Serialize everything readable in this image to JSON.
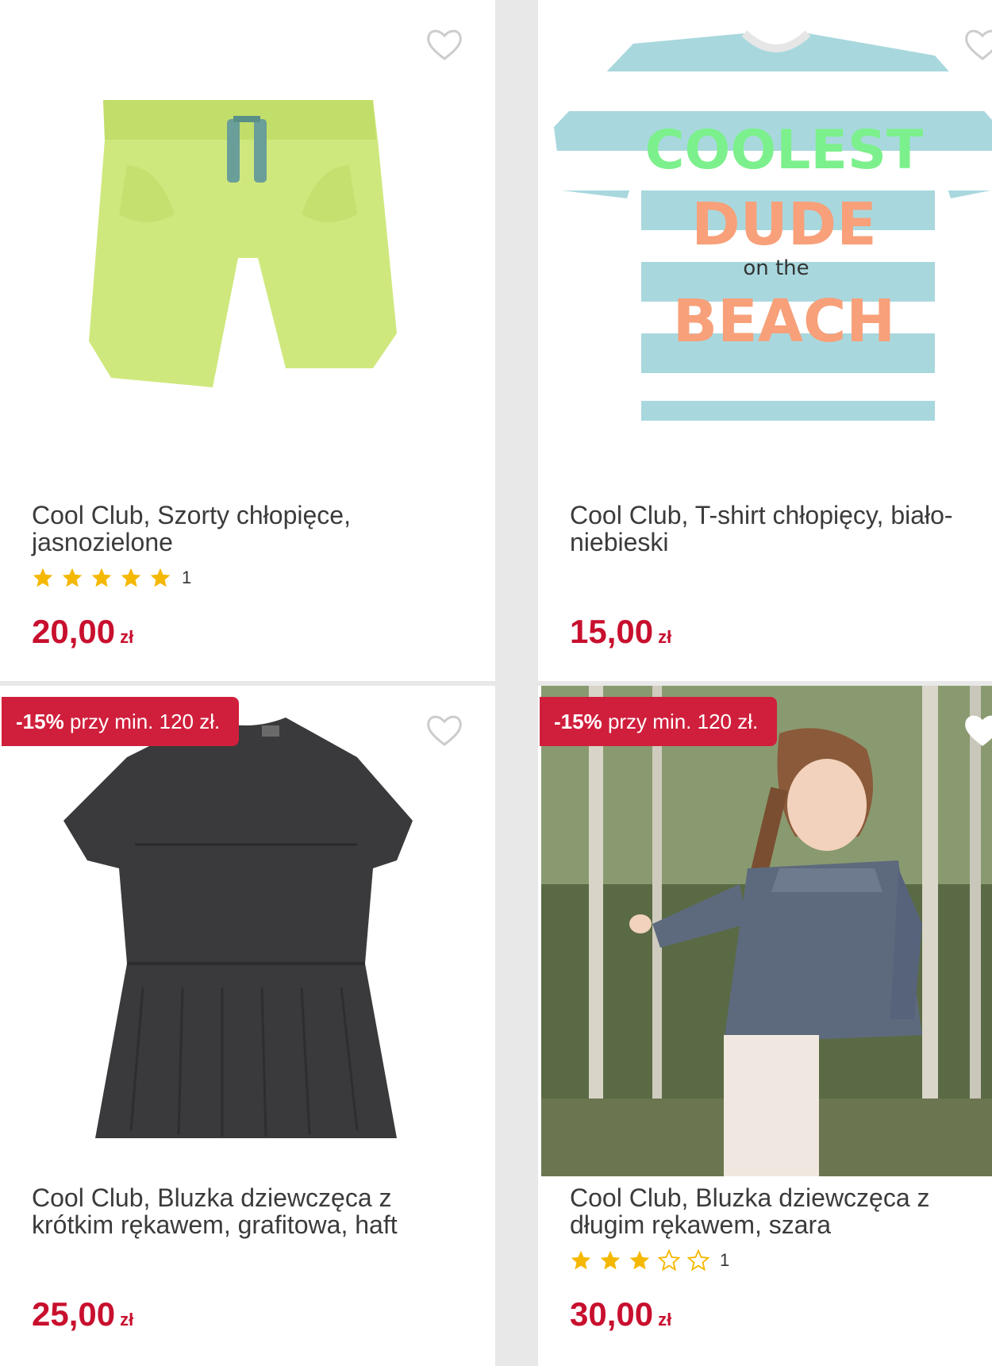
{
  "products": [
    {
      "title": "Cool Club, Szorty chłopięce, jasnozielone",
      "price": "20,00",
      "currency": "zł",
      "rating_count": "1",
      "rating": 5,
      "image": "lime-green-shorts",
      "badge": null
    },
    {
      "title": "Cool Club, T-shirt chłopięcy, biało-niebieski",
      "price": "15,00",
      "currency": "zł",
      "image": "striped-tshirt",
      "shirt_text": [
        "COOLEST",
        "DUDE",
        "on the",
        "BEACH"
      ],
      "badge": null
    },
    {
      "title": "Cool Club, Bluzka dziewczęca z krótkim rękawem, grafitowa, haft",
      "price": "25,00",
      "currency": "zł",
      "image": "graphite-blouse",
      "badge": {
        "discount": "-15%",
        "text": "przy min. 120 zł."
      }
    },
    {
      "title": "Cool Club, Bluzka dziewczęca z długim rękawem, szara",
      "price": "30,00",
      "currency": "zł",
      "rating_count": "1",
      "rating": 3,
      "image": "girl-grey-blouse-photo",
      "badge": {
        "discount": "-15%",
        "text": "przy min. 120 zł."
      }
    }
  ],
  "colors": {
    "price": "#c8102e",
    "badge": "#d01f3c",
    "star": "#f5b800",
    "heart": "#cccccc"
  }
}
